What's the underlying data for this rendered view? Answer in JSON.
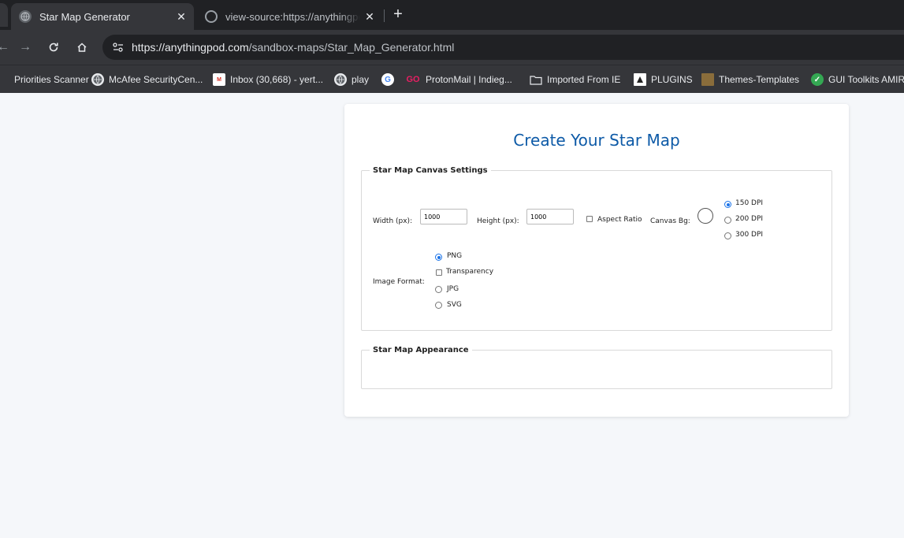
{
  "browser": {
    "tabs": [
      {
        "title": "Star Map Generator",
        "active": true,
        "close": "✕"
      },
      {
        "title": "view-source:https://anythingpod.com",
        "active": false,
        "close": "✕"
      }
    ],
    "new_tab": "+",
    "url": {
      "host": "https://anythingpod.com",
      "path": "/sandbox-maps/Star_Map_Generator.html"
    },
    "bookmarks": [
      {
        "label": "Priorities Scanner",
        "icon": "globe-icon"
      },
      {
        "label": "McAfee SecurityCen...",
        "icon": "globe-icon"
      },
      {
        "label": "Inbox (30,668) - yert...",
        "icon": "gmail-icon"
      },
      {
        "label": "play",
        "icon": "globe-icon"
      },
      {
        "label": "",
        "icon": "google-icon"
      },
      {
        "label": "ProtonMail | Indieg...",
        "icon": "go-icon"
      },
      {
        "label": "Imported From IE",
        "icon": "folder-icon"
      },
      {
        "label": "PLUGINS",
        "icon": "plugin-icon"
      },
      {
        "label": "Themes-Templates",
        "icon": "theme-icon"
      },
      {
        "label": "GUI Toolkits AMIR",
        "icon": "check-icon"
      }
    ]
  },
  "page": {
    "title": "Create Your Star Map",
    "canvas_settings": {
      "legend": "Star Map Canvas Settings",
      "width_label": "Width (px):",
      "width_value": "1000",
      "height_label": "Height (px):",
      "height_value": "1000",
      "aspect_label": "Aspect Ratio",
      "canvas_bg_label": "Canvas Bg:",
      "dpi_options": [
        {
          "label": "150 DPI",
          "selected": true
        },
        {
          "label": "200 DPI",
          "selected": false
        },
        {
          "label": "300 DPI",
          "selected": false
        }
      ],
      "image_format_label": "Image Format:",
      "format_png": "PNG",
      "transparency_label": "Transparency",
      "format_jpg": "JPG",
      "format_svg": "SVG"
    },
    "appearance": {
      "legend": "Star Map Appearance"
    }
  }
}
